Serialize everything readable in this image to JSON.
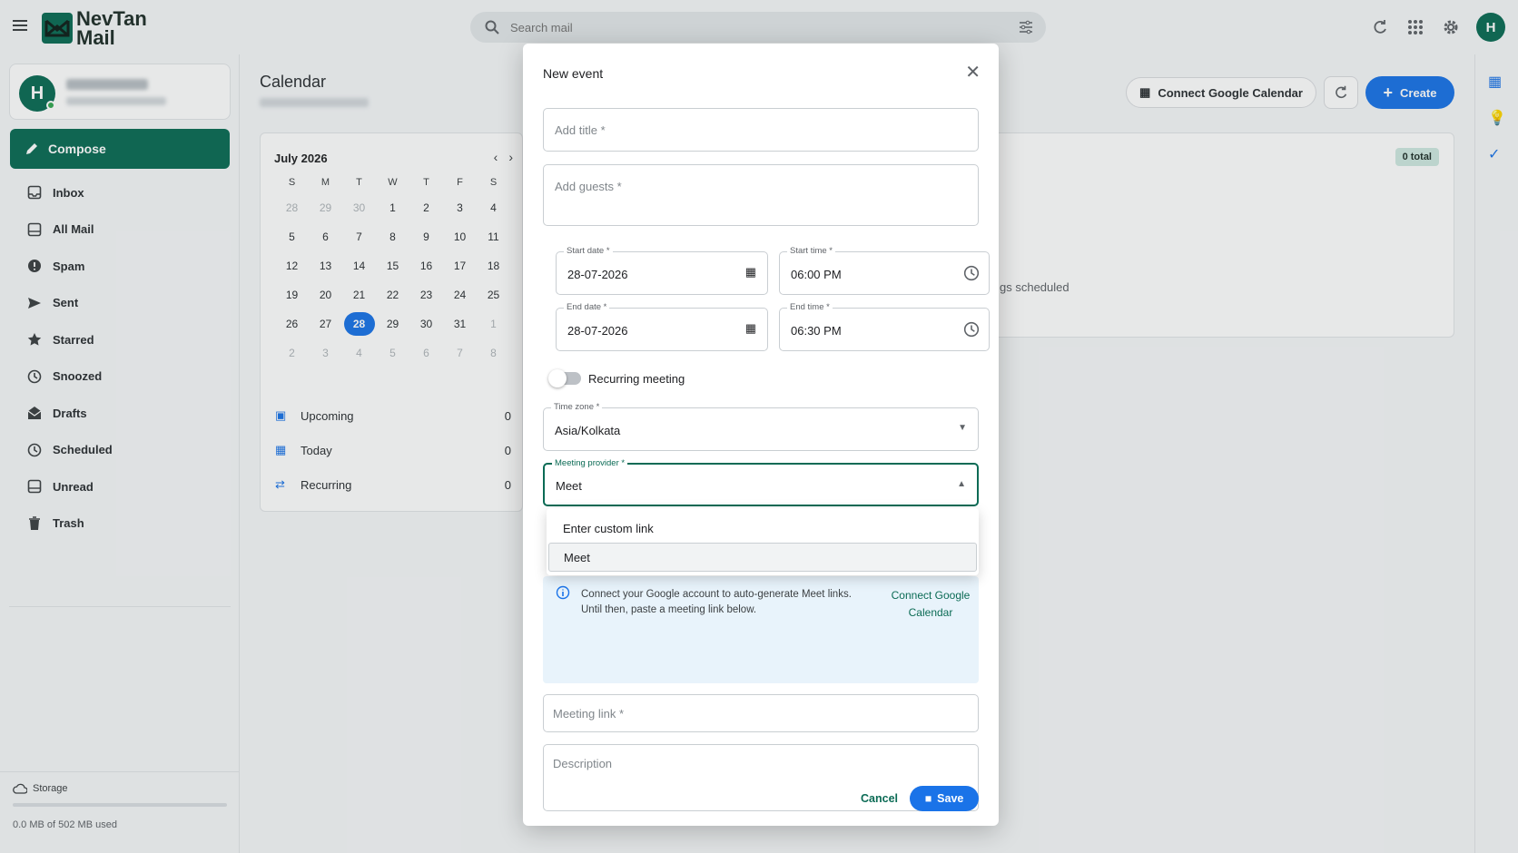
{
  "app": {
    "brand_line1": "NevTan",
    "brand_line2": "Mail",
    "avatar_initial": "H"
  },
  "search": {
    "placeholder": "Search mail"
  },
  "sidebar": {
    "profile_initial": "H",
    "compose_label": "Compose",
    "items": [
      {
        "label": "Inbox",
        "icon": "inbox-icon"
      },
      {
        "label": "All Mail",
        "icon": "all-mail-icon"
      },
      {
        "label": "Spam",
        "icon": "spam-icon"
      },
      {
        "label": "Sent",
        "icon": "sent-icon"
      },
      {
        "label": "Starred",
        "icon": "star-icon"
      },
      {
        "label": "Snoozed",
        "icon": "clock-icon"
      },
      {
        "label": "Drafts",
        "icon": "drafts-icon"
      },
      {
        "label": "Scheduled",
        "icon": "clock-icon"
      },
      {
        "label": "Unread",
        "icon": "unread-icon"
      },
      {
        "label": "Trash",
        "icon": "trash-icon"
      }
    ],
    "storage_label": "Storage",
    "storage_used": "0.0 MB of 502 MB used"
  },
  "calendar": {
    "title": "Calendar",
    "month_label": "July 2026",
    "weekdays": [
      "S",
      "M",
      "T",
      "W",
      "T",
      "F",
      "S"
    ],
    "days": [
      "28",
      "29",
      "30",
      "1",
      "2",
      "3",
      "4",
      "5",
      "6",
      "7",
      "8",
      "9",
      "10",
      "11",
      "12",
      "13",
      "14",
      "15",
      "16",
      "17",
      "18",
      "19",
      "20",
      "21",
      "22",
      "23",
      "24",
      "25",
      "26",
      "27",
      "28",
      "29",
      "30",
      "31",
      "1",
      "2",
      "3",
      "4",
      "5",
      "6",
      "7",
      "8"
    ],
    "selected_day": "28",
    "counts": [
      {
        "label": "Upcoming",
        "count": "0"
      },
      {
        "label": "Today",
        "count": "0"
      },
      {
        "label": "Recurring",
        "count": "0"
      }
    ],
    "total_badge": "0 total",
    "empty_text": "gs scheduled",
    "connect_label": "Connect Google Calendar",
    "create_label": "Create"
  },
  "modal": {
    "title": "New event",
    "title_placeholder": "Add title *",
    "guests_placeholder": "Add guests *",
    "start_date_label": "Start date *",
    "start_date_value": "28-07-2026",
    "start_time_label": "Start time *",
    "start_time_value": "06:00 PM",
    "end_date_label": "End date *",
    "end_date_value": "28-07-2026",
    "end_time_label": "End time *",
    "end_time_value": "06:30 PM",
    "recurring_label": "Recurring meeting",
    "timezone_label": "Time zone *",
    "timezone_value": "Asia/Kolkata",
    "provider_label": "Meeting provider *",
    "provider_value": "Meet",
    "options": [
      "Enter custom link",
      "Meet"
    ],
    "info_text": "Connect your Google account to auto-generate Meet links. Until then, paste a meeting link below.",
    "info_link": "Connect Google Calendar",
    "link_placeholder": "Meeting link *",
    "description_placeholder": "Description",
    "cancel_label": "Cancel",
    "save_label": "Save"
  },
  "colors": {
    "brand": "#0b6b55",
    "accent": "#1a73e8"
  }
}
